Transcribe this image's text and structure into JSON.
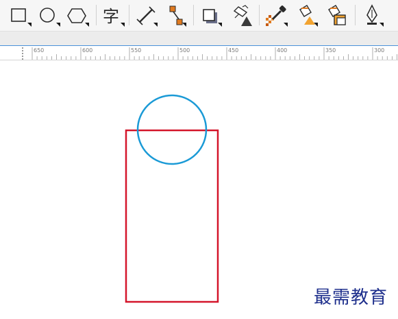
{
  "toolbar": {
    "tools": [
      {
        "id": "rectangle-tool",
        "icon": "rectangle-icon"
      },
      {
        "id": "ellipse-tool",
        "icon": "ellipse-icon"
      },
      {
        "id": "polygon-tool",
        "icon": "polygon-icon"
      },
      {
        "id": "text-tool",
        "icon": "text-icon",
        "glyph": "字"
      },
      {
        "id": "dimension-tool",
        "icon": "dimension-icon"
      },
      {
        "id": "connector-tool",
        "icon": "connector-icon"
      },
      {
        "id": "drop-shadow-tool",
        "icon": "drop-shadow-icon"
      },
      {
        "id": "transparency-tool",
        "icon": "transparency-icon"
      },
      {
        "id": "color-eyedropper-tool",
        "icon": "eyedropper-icon"
      },
      {
        "id": "interactive-fill-tool",
        "icon": "fill-icon"
      },
      {
        "id": "smart-fill-tool",
        "icon": "smart-fill-icon"
      },
      {
        "id": "pen-tool",
        "icon": "pen-icon"
      }
    ]
  },
  "ruler": {
    "labels": [
      "650",
      "600",
      "550",
      "500",
      "450",
      "400",
      "350",
      "300"
    ]
  },
  "colors": {
    "circle_stroke": "#1a9ad6",
    "rectangle_stroke": "#d4152a",
    "ruler_accent": "#4a90d9",
    "watermark": "#1e2f8c"
  },
  "watermark": {
    "text": "最需教育"
  }
}
